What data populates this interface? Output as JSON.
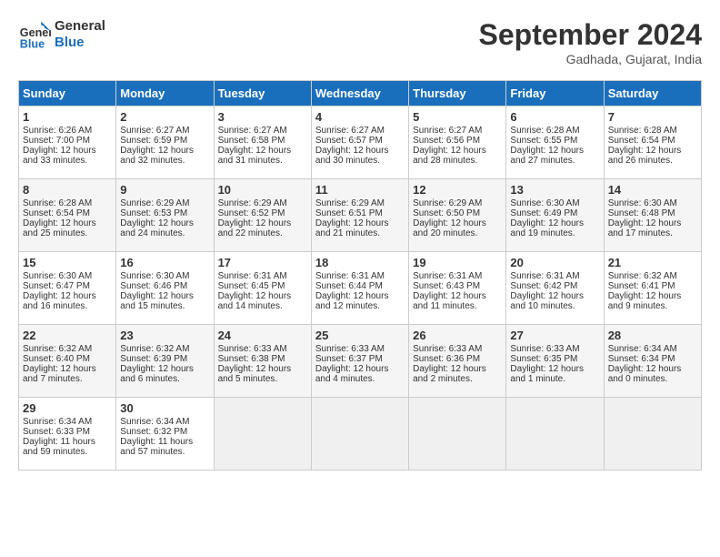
{
  "header": {
    "logo_line1": "General",
    "logo_line2": "Blue",
    "month": "September 2024",
    "location": "Gadhada, Gujarat, India"
  },
  "days_of_week": [
    "Sunday",
    "Monday",
    "Tuesday",
    "Wednesday",
    "Thursday",
    "Friday",
    "Saturday"
  ],
  "weeks": [
    [
      {
        "day": "1",
        "info": "Sunrise: 6:26 AM\nSunset: 7:00 PM\nDaylight: 12 hours\nand 33 minutes."
      },
      {
        "day": "2",
        "info": "Sunrise: 6:27 AM\nSunset: 6:59 PM\nDaylight: 12 hours\nand 32 minutes."
      },
      {
        "day": "3",
        "info": "Sunrise: 6:27 AM\nSunset: 6:58 PM\nDaylight: 12 hours\nand 31 minutes."
      },
      {
        "day": "4",
        "info": "Sunrise: 6:27 AM\nSunset: 6:57 PM\nDaylight: 12 hours\nand 30 minutes."
      },
      {
        "day": "5",
        "info": "Sunrise: 6:27 AM\nSunset: 6:56 PM\nDaylight: 12 hours\nand 28 minutes."
      },
      {
        "day": "6",
        "info": "Sunrise: 6:28 AM\nSunset: 6:55 PM\nDaylight: 12 hours\nand 27 minutes."
      },
      {
        "day": "7",
        "info": "Sunrise: 6:28 AM\nSunset: 6:54 PM\nDaylight: 12 hours\nand 26 minutes."
      }
    ],
    [
      {
        "day": "8",
        "info": "Sunrise: 6:28 AM\nSunset: 6:54 PM\nDaylight: 12 hours\nand 25 minutes."
      },
      {
        "day": "9",
        "info": "Sunrise: 6:29 AM\nSunset: 6:53 PM\nDaylight: 12 hours\nand 24 minutes."
      },
      {
        "day": "10",
        "info": "Sunrise: 6:29 AM\nSunset: 6:52 PM\nDaylight: 12 hours\nand 22 minutes."
      },
      {
        "day": "11",
        "info": "Sunrise: 6:29 AM\nSunset: 6:51 PM\nDaylight: 12 hours\nand 21 minutes."
      },
      {
        "day": "12",
        "info": "Sunrise: 6:29 AM\nSunset: 6:50 PM\nDaylight: 12 hours\nand 20 minutes."
      },
      {
        "day": "13",
        "info": "Sunrise: 6:30 AM\nSunset: 6:49 PM\nDaylight: 12 hours\nand 19 minutes."
      },
      {
        "day": "14",
        "info": "Sunrise: 6:30 AM\nSunset: 6:48 PM\nDaylight: 12 hours\nand 17 minutes."
      }
    ],
    [
      {
        "day": "15",
        "info": "Sunrise: 6:30 AM\nSunset: 6:47 PM\nDaylight: 12 hours\nand 16 minutes."
      },
      {
        "day": "16",
        "info": "Sunrise: 6:30 AM\nSunset: 6:46 PM\nDaylight: 12 hours\nand 15 minutes."
      },
      {
        "day": "17",
        "info": "Sunrise: 6:31 AM\nSunset: 6:45 PM\nDaylight: 12 hours\nand 14 minutes."
      },
      {
        "day": "18",
        "info": "Sunrise: 6:31 AM\nSunset: 6:44 PM\nDaylight: 12 hours\nand 12 minutes."
      },
      {
        "day": "19",
        "info": "Sunrise: 6:31 AM\nSunset: 6:43 PM\nDaylight: 12 hours\nand 11 minutes."
      },
      {
        "day": "20",
        "info": "Sunrise: 6:31 AM\nSunset: 6:42 PM\nDaylight: 12 hours\nand 10 minutes."
      },
      {
        "day": "21",
        "info": "Sunrise: 6:32 AM\nSunset: 6:41 PM\nDaylight: 12 hours\nand 9 minutes."
      }
    ],
    [
      {
        "day": "22",
        "info": "Sunrise: 6:32 AM\nSunset: 6:40 PM\nDaylight: 12 hours\nand 7 minutes."
      },
      {
        "day": "23",
        "info": "Sunrise: 6:32 AM\nSunset: 6:39 PM\nDaylight: 12 hours\nand 6 minutes."
      },
      {
        "day": "24",
        "info": "Sunrise: 6:33 AM\nSunset: 6:38 PM\nDaylight: 12 hours\nand 5 minutes."
      },
      {
        "day": "25",
        "info": "Sunrise: 6:33 AM\nSunset: 6:37 PM\nDaylight: 12 hours\nand 4 minutes."
      },
      {
        "day": "26",
        "info": "Sunrise: 6:33 AM\nSunset: 6:36 PM\nDaylight: 12 hours\nand 2 minutes."
      },
      {
        "day": "27",
        "info": "Sunrise: 6:33 AM\nSunset: 6:35 PM\nDaylight: 12 hours\nand 1 minute."
      },
      {
        "day": "28",
        "info": "Sunrise: 6:34 AM\nSunset: 6:34 PM\nDaylight: 12 hours\nand 0 minutes."
      }
    ],
    [
      {
        "day": "29",
        "info": "Sunrise: 6:34 AM\nSunset: 6:33 PM\nDaylight: 11 hours\nand 59 minutes."
      },
      {
        "day": "30",
        "info": "Sunrise: 6:34 AM\nSunset: 6:32 PM\nDaylight: 11 hours\nand 57 minutes."
      },
      {
        "day": "",
        "info": ""
      },
      {
        "day": "",
        "info": ""
      },
      {
        "day": "",
        "info": ""
      },
      {
        "day": "",
        "info": ""
      },
      {
        "day": "",
        "info": ""
      }
    ]
  ]
}
